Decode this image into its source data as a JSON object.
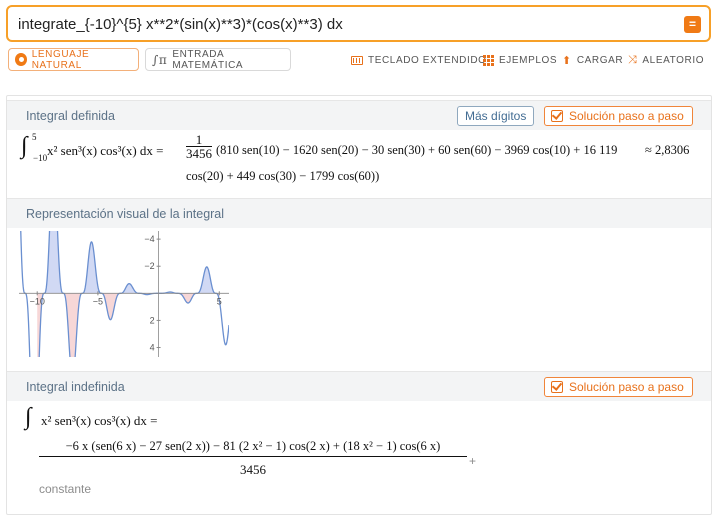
{
  "search": {
    "query": "integrate_{-10}^{5} x**2*(sin(x)**3)*(cos(x)**3) dx",
    "go_icon": "equals-icon"
  },
  "modes": {
    "natural": "LENGUAJE NATURAL",
    "math": "ENTRADA MATEMÁTICA"
  },
  "tools": {
    "keyboard": "TECLADO EXTENDIDO",
    "examples": "EJEMPLOS",
    "upload": "CARGAR",
    "random": "ALEATORIO"
  },
  "accent_color": "#f07a15",
  "pods": {
    "definite": {
      "title": "Integral definida",
      "more_digits": "Más dígitos",
      "step_by_step": "Solución paso a paso",
      "lhs": "x² sen³(x) cos³(x) dx =",
      "lower": "−10",
      "upper": "5",
      "frac_num": "1",
      "frac_den": "3456",
      "rhs_line1": "(810 sen(10) − 1620 sen(20) − 30 sen(30) + 60 sen(60) − 3969 cos(10) + 16 119",
      "approx": "≈ 2,8306",
      "rhs_line2": "cos(20) + 449 cos(30) − 1799 cos(60))"
    },
    "visual": {
      "title": "Representación visual de la integral",
      "x_ticks": [
        "−10",
        "−5",
        "5"
      ],
      "y_ticks": [
        "4",
        "2",
        "−2",
        "−4"
      ]
    },
    "indefinite": {
      "title": "Integral indefinida",
      "step_by_step": "Solución paso a paso",
      "lhs": "x² sen³(x) cos³(x) dx =",
      "numerator": "−6 x (sen(6 x) − 27 sen(2 x)) − 81 (2 x² − 1) cos(2 x) + (18 x² − 1) cos(6 x)",
      "denominator": "3456",
      "plus": "+",
      "constant": "constante"
    }
  },
  "chart_data": {
    "type": "area",
    "xlim": [
      -11.5,
      5.8
    ],
    "ylim": [
      -4.7,
      4.6
    ],
    "x_ticks": [
      -10,
      -5,
      5
    ],
    "y_ticks": [
      -4,
      -2,
      2,
      4
    ],
    "integration_range": [
      -10,
      5
    ],
    "positive_fill": "#c9d2f2",
    "negative_fill": "#f6d0d0",
    "line_color": "#6a8fd0"
  }
}
